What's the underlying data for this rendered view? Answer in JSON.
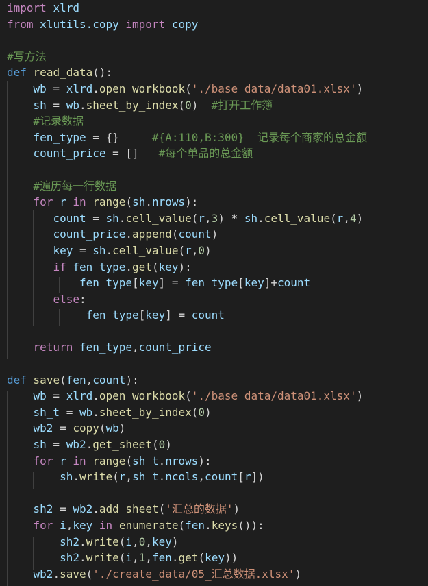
{
  "editor": {
    "language": "python",
    "theme_background": "#1e1e1e",
    "lines": [
      [
        {
          "t": "import",
          "c": "kw"
        },
        {
          "t": " "
        },
        {
          "t": "xlrd",
          "c": "var"
        }
      ],
      [
        {
          "t": "from",
          "c": "kw"
        },
        {
          "t": " "
        },
        {
          "t": "xlutils.copy",
          "c": "var"
        },
        {
          "t": " "
        },
        {
          "t": "import",
          "c": "kw"
        },
        {
          "t": " "
        },
        {
          "t": "copy",
          "c": "var"
        }
      ],
      [],
      [
        {
          "t": "#写方法",
          "c": "cmt"
        }
      ],
      [
        {
          "t": "def",
          "c": "def"
        },
        {
          "t": " "
        },
        {
          "t": "read_data",
          "c": "fn"
        },
        {
          "t": "():"
        }
      ],
      [
        {
          "t": "    "
        },
        {
          "t": "wb",
          "c": "var"
        },
        {
          "t": " = "
        },
        {
          "t": "xlrd",
          "c": "var"
        },
        {
          "t": "."
        },
        {
          "t": "open_workbook",
          "c": "fn"
        },
        {
          "t": "("
        },
        {
          "t": "'./base_data/data01.xlsx'",
          "c": "str"
        },
        {
          "t": ")"
        }
      ],
      [
        {
          "t": "    "
        },
        {
          "t": "sh",
          "c": "var"
        },
        {
          "t": " = "
        },
        {
          "t": "wb",
          "c": "var"
        },
        {
          "t": "."
        },
        {
          "t": "sheet_by_index",
          "c": "fn"
        },
        {
          "t": "("
        },
        {
          "t": "0",
          "c": "num"
        },
        {
          "t": ")  "
        },
        {
          "t": "#打开工作簿",
          "c": "cmt"
        }
      ],
      [
        {
          "t": "    "
        },
        {
          "t": "#记录数据",
          "c": "cmt"
        }
      ],
      [
        {
          "t": "    "
        },
        {
          "t": "fen_type",
          "c": "var"
        },
        {
          "t": " = {}     "
        },
        {
          "t": "#{A:110,B:300}  记录每个商家的总金额",
          "c": "cmt"
        }
      ],
      [
        {
          "t": "    "
        },
        {
          "t": "count_price",
          "c": "var"
        },
        {
          "t": " = []   "
        },
        {
          "t": "#每个单品的总金额",
          "c": "cmt"
        }
      ],
      [],
      [
        {
          "t": "    "
        },
        {
          "t": "#遍历每一行数据",
          "c": "cmt"
        }
      ],
      [
        {
          "t": "    "
        },
        {
          "t": "for",
          "c": "kw"
        },
        {
          "t": " "
        },
        {
          "t": "r",
          "c": "var"
        },
        {
          "t": " "
        },
        {
          "t": "in",
          "c": "kw"
        },
        {
          "t": " "
        },
        {
          "t": "range",
          "c": "fn"
        },
        {
          "t": "("
        },
        {
          "t": "sh",
          "c": "var"
        },
        {
          "t": "."
        },
        {
          "t": "nrows",
          "c": "var"
        },
        {
          "t": "):"
        }
      ],
      [
        {
          "t": "       "
        },
        {
          "t": "count",
          "c": "var"
        },
        {
          "t": " = "
        },
        {
          "t": "sh",
          "c": "var"
        },
        {
          "t": "."
        },
        {
          "t": "cell_value",
          "c": "fn"
        },
        {
          "t": "("
        },
        {
          "t": "r",
          "c": "var"
        },
        {
          "t": ","
        },
        {
          "t": "3",
          "c": "num"
        },
        {
          "t": ") * "
        },
        {
          "t": "sh",
          "c": "var"
        },
        {
          "t": "."
        },
        {
          "t": "cell_value",
          "c": "fn"
        },
        {
          "t": "("
        },
        {
          "t": "r",
          "c": "var"
        },
        {
          "t": ","
        },
        {
          "t": "4",
          "c": "num"
        },
        {
          "t": ")"
        }
      ],
      [
        {
          "t": "       "
        },
        {
          "t": "count_price",
          "c": "var"
        },
        {
          "t": "."
        },
        {
          "t": "append",
          "c": "fn"
        },
        {
          "t": "("
        },
        {
          "t": "count",
          "c": "var"
        },
        {
          "t": ")"
        }
      ],
      [
        {
          "t": "       "
        },
        {
          "t": "key",
          "c": "var"
        },
        {
          "t": " = "
        },
        {
          "t": "sh",
          "c": "var"
        },
        {
          "t": "."
        },
        {
          "t": "cell_value",
          "c": "fn"
        },
        {
          "t": "("
        },
        {
          "t": "r",
          "c": "var"
        },
        {
          "t": ","
        },
        {
          "t": "0",
          "c": "num"
        },
        {
          "t": ")"
        }
      ],
      [
        {
          "t": "       "
        },
        {
          "t": "if",
          "c": "kw"
        },
        {
          "t": " "
        },
        {
          "t": "fen_type",
          "c": "var"
        },
        {
          "t": "."
        },
        {
          "t": "get",
          "c": "fn"
        },
        {
          "t": "("
        },
        {
          "t": "key",
          "c": "var"
        },
        {
          "t": "):"
        }
      ],
      [
        {
          "t": "           "
        },
        {
          "t": "fen_type",
          "c": "var"
        },
        {
          "t": "["
        },
        {
          "t": "key",
          "c": "var"
        },
        {
          "t": "] = "
        },
        {
          "t": "fen_type",
          "c": "var"
        },
        {
          "t": "["
        },
        {
          "t": "key",
          "c": "var"
        },
        {
          "t": "]+"
        },
        {
          "t": "count",
          "c": "var"
        }
      ],
      [
        {
          "t": "       "
        },
        {
          "t": "else",
          "c": "kw"
        },
        {
          "t": ":"
        }
      ],
      [
        {
          "t": "            "
        },
        {
          "t": "fen_type",
          "c": "var"
        },
        {
          "t": "["
        },
        {
          "t": "key",
          "c": "var"
        },
        {
          "t": "] = "
        },
        {
          "t": "count",
          "c": "var"
        }
      ],
      [],
      [
        {
          "t": "    "
        },
        {
          "t": "return",
          "c": "kw"
        },
        {
          "t": " "
        },
        {
          "t": "fen_type",
          "c": "var"
        },
        {
          "t": ","
        },
        {
          "t": "count_price",
          "c": "var"
        }
      ],
      [],
      [
        {
          "t": "def",
          "c": "def"
        },
        {
          "t": " "
        },
        {
          "t": "save",
          "c": "fn"
        },
        {
          "t": "("
        },
        {
          "t": "fen",
          "c": "var"
        },
        {
          "t": ","
        },
        {
          "t": "count",
          "c": "var"
        },
        {
          "t": "):"
        }
      ],
      [
        {
          "t": "    "
        },
        {
          "t": "wb",
          "c": "var"
        },
        {
          "t": " = "
        },
        {
          "t": "xlrd",
          "c": "var"
        },
        {
          "t": "."
        },
        {
          "t": "open_workbook",
          "c": "fn"
        },
        {
          "t": "("
        },
        {
          "t": "'./base_data/data01.xlsx'",
          "c": "str"
        },
        {
          "t": ")"
        }
      ],
      [
        {
          "t": "    "
        },
        {
          "t": "sh_t",
          "c": "var"
        },
        {
          "t": " = "
        },
        {
          "t": "wb",
          "c": "var"
        },
        {
          "t": "."
        },
        {
          "t": "sheet_by_index",
          "c": "fn"
        },
        {
          "t": "("
        },
        {
          "t": "0",
          "c": "num"
        },
        {
          "t": ")"
        }
      ],
      [
        {
          "t": "    "
        },
        {
          "t": "wb2",
          "c": "var"
        },
        {
          "t": " = "
        },
        {
          "t": "copy",
          "c": "fn"
        },
        {
          "t": "("
        },
        {
          "t": "wb",
          "c": "var"
        },
        {
          "t": ")"
        }
      ],
      [
        {
          "t": "    "
        },
        {
          "t": "sh",
          "c": "var"
        },
        {
          "t": " = "
        },
        {
          "t": "wb2",
          "c": "var"
        },
        {
          "t": "."
        },
        {
          "t": "get_sheet",
          "c": "fn"
        },
        {
          "t": "("
        },
        {
          "t": "0",
          "c": "num"
        },
        {
          "t": ")"
        }
      ],
      [
        {
          "t": "    "
        },
        {
          "t": "for",
          "c": "kw"
        },
        {
          "t": " "
        },
        {
          "t": "r",
          "c": "var"
        },
        {
          "t": " "
        },
        {
          "t": "in",
          "c": "kw"
        },
        {
          "t": " "
        },
        {
          "t": "range",
          "c": "fn"
        },
        {
          "t": "("
        },
        {
          "t": "sh_t",
          "c": "var"
        },
        {
          "t": "."
        },
        {
          "t": "nrows",
          "c": "var"
        },
        {
          "t": "):"
        }
      ],
      [
        {
          "t": "        "
        },
        {
          "t": "sh",
          "c": "var"
        },
        {
          "t": "."
        },
        {
          "t": "write",
          "c": "fn"
        },
        {
          "t": "("
        },
        {
          "t": "r",
          "c": "var"
        },
        {
          "t": ","
        },
        {
          "t": "sh_t",
          "c": "var"
        },
        {
          "t": "."
        },
        {
          "t": "ncols",
          "c": "var"
        },
        {
          "t": ","
        },
        {
          "t": "count",
          "c": "var"
        },
        {
          "t": "["
        },
        {
          "t": "r",
          "c": "var"
        },
        {
          "t": "])"
        }
      ],
      [],
      [
        {
          "t": "    "
        },
        {
          "t": "sh2",
          "c": "var"
        },
        {
          "t": " = "
        },
        {
          "t": "wb2",
          "c": "var"
        },
        {
          "t": "."
        },
        {
          "t": "add_sheet",
          "c": "fn"
        },
        {
          "t": "("
        },
        {
          "t": "'汇总的数据'",
          "c": "str"
        },
        {
          "t": ")"
        }
      ],
      [
        {
          "t": "    "
        },
        {
          "t": "for",
          "c": "kw"
        },
        {
          "t": " "
        },
        {
          "t": "i",
          "c": "var"
        },
        {
          "t": ","
        },
        {
          "t": "key",
          "c": "var"
        },
        {
          "t": " "
        },
        {
          "t": "in",
          "c": "kw"
        },
        {
          "t": " "
        },
        {
          "t": "enumerate",
          "c": "fn"
        },
        {
          "t": "("
        },
        {
          "t": "fen",
          "c": "var"
        },
        {
          "t": "."
        },
        {
          "t": "keys",
          "c": "fn"
        },
        {
          "t": "()):"
        }
      ],
      [
        {
          "t": "        "
        },
        {
          "t": "sh2",
          "c": "var"
        },
        {
          "t": "."
        },
        {
          "t": "write",
          "c": "fn"
        },
        {
          "t": "("
        },
        {
          "t": "i",
          "c": "var"
        },
        {
          "t": ","
        },
        {
          "t": "0",
          "c": "num"
        },
        {
          "t": ","
        },
        {
          "t": "key",
          "c": "var"
        },
        {
          "t": ")"
        }
      ],
      [
        {
          "t": "        "
        },
        {
          "t": "sh2",
          "c": "var"
        },
        {
          "t": "."
        },
        {
          "t": "write",
          "c": "fn"
        },
        {
          "t": "("
        },
        {
          "t": "i",
          "c": "var"
        },
        {
          "t": ","
        },
        {
          "t": "1",
          "c": "num"
        },
        {
          "t": ","
        },
        {
          "t": "fen",
          "c": "var"
        },
        {
          "t": "."
        },
        {
          "t": "get",
          "c": "fn"
        },
        {
          "t": "("
        },
        {
          "t": "key",
          "c": "var"
        },
        {
          "t": "))"
        }
      ],
      [
        {
          "t": "    "
        },
        {
          "t": "wb2",
          "c": "var"
        },
        {
          "t": "."
        },
        {
          "t": "save",
          "c": "fn"
        },
        {
          "t": "("
        },
        {
          "t": "'./create_data/05_汇总数据.xlsx'",
          "c": "str"
        },
        {
          "t": ")"
        }
      ]
    ]
  }
}
